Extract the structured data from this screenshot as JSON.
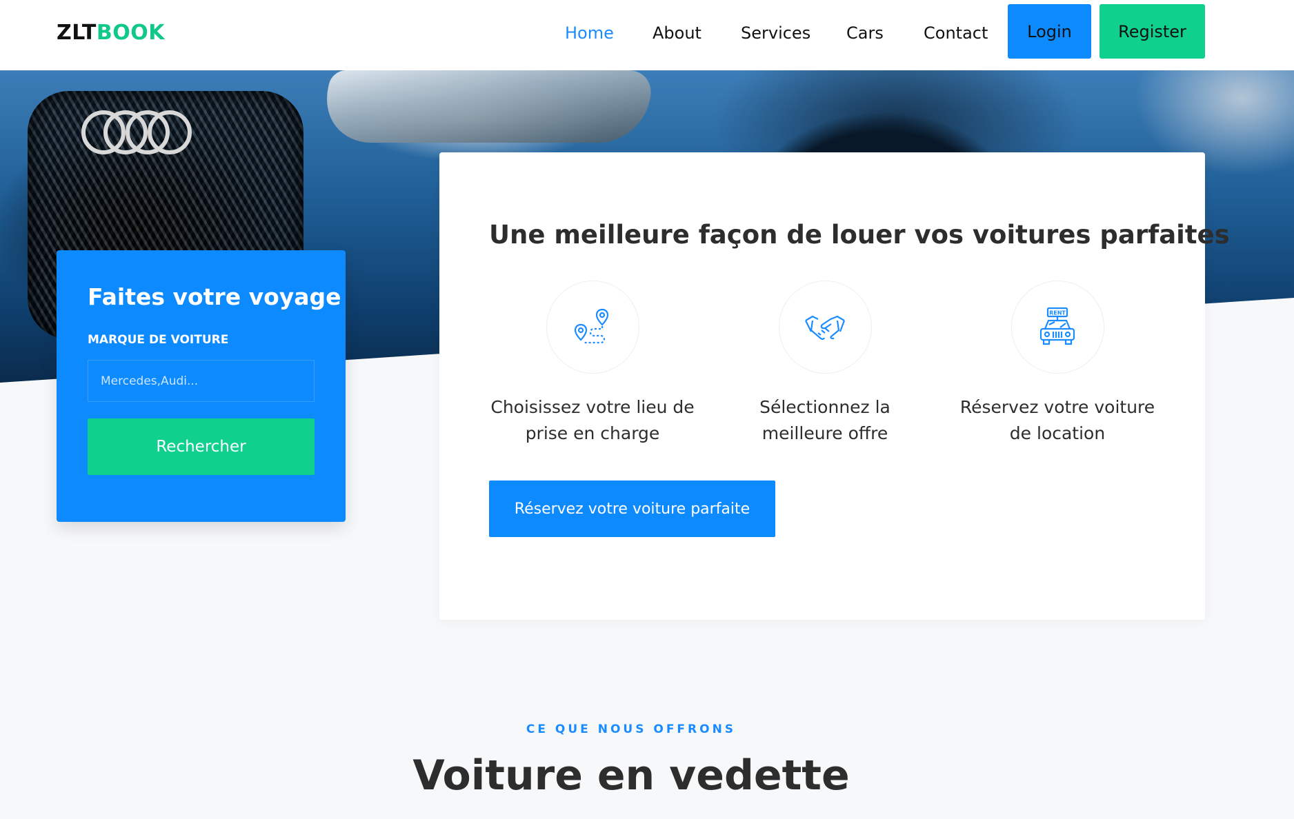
{
  "brand": {
    "part1": "ZLT",
    "part2": "BOOK"
  },
  "nav": {
    "links": [
      "Home",
      "About",
      "Services",
      "Cars",
      "Contact"
    ],
    "active": "Home",
    "login_label": "Login",
    "register_label": "Register"
  },
  "search": {
    "title": "Faites votre voyage",
    "field_label": "MARQUE DE VOITURE",
    "placeholder": "Mercedes,Audi...",
    "button_label": "Rechercher"
  },
  "hero": {
    "title": "Une meilleure façon de louer vos voitures parfaites",
    "steps": [
      {
        "icon": "location-route-icon",
        "text": "Choisissez votre lieu de prise en charge"
      },
      {
        "icon": "handshake-icon",
        "text": "Sélectionnez la meilleure offre"
      },
      {
        "icon": "rent-car-icon",
        "text": "Réservez votre voiture de location"
      }
    ],
    "cta_label": "Réservez votre voiture parfaite"
  },
  "featured": {
    "subtitle": "CE QUE NOUS OFFRONS",
    "title": "Voiture en vedette"
  },
  "colors": {
    "primary": "#0e8aff",
    "accent": "#0fd08d",
    "text": "#2d2d2d",
    "background": "#f7f8fa"
  }
}
